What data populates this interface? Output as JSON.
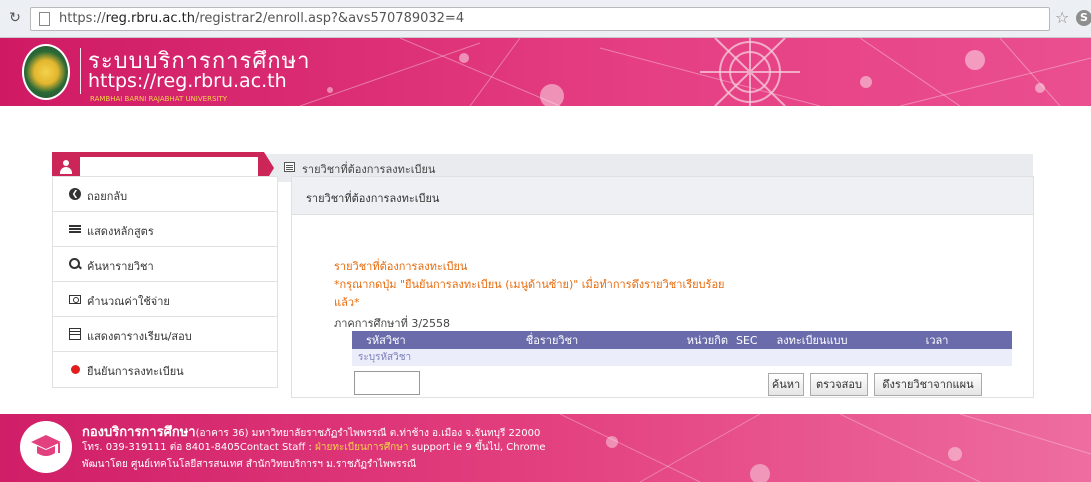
{
  "browser": {
    "url_prefix": "https://",
    "url_host": "reg.rbru.ac.th",
    "url_path": "/registrar2/enroll.asp?&avs570789032=4"
  },
  "header": {
    "title": "ระบบบริการการศึกษา",
    "url": "https://reg.rbru.ac.th",
    "university": "RAMBHAI BARNI RAJABHAT UNIVERSITY"
  },
  "breadcrumb": {
    "current": "รายวิชาที่ต้องการลงทะเบียน"
  },
  "sidebar": {
    "items": [
      {
        "label": "ถอยกลับ",
        "icon": "back-circle-icon"
      },
      {
        "label": "แสดงหลักสูตร",
        "icon": "list-icon"
      },
      {
        "label": "ค้นหารายวิชา",
        "icon": "search-icon"
      },
      {
        "label": "คำนวณค่าใช้จ่าย",
        "icon": "money-icon"
      },
      {
        "label": "แสดงตารางเรียน/สอบ",
        "icon": "calendar-icon"
      },
      {
        "label": "ยืนยันการลงทะเบียน",
        "icon": "red-dot-icon"
      }
    ]
  },
  "panel": {
    "heading": "รายวิชาที่ต้องการลงทะเบียน",
    "notice_title": "รายวิชาที่ต้องการลงทะเบียน",
    "notice_line1": "*กรุณากดปุ่ม \"ยืนยันการลงทะเบียน (เมนูด้านซ้าย)\" เมื่อทำการดึงรายวิชาเรียบร้อย",
    "notice_line2": "แล้ว*",
    "term": "ภาคการศึกษาที่ 3/2558",
    "table": {
      "headers": [
        "รหัสวิชา",
        "ชื่อรายวิชา",
        "หน่วยกิต",
        "SEC",
        "ลงทะเบียนแบบ",
        "เวลา"
      ],
      "empty_row": "ระบุรหัสวิชา"
    },
    "buttons": {
      "search": "ค้นหา",
      "check": "ตรวจสอบ",
      "pull_plan": "ดึงรายวิชาจากแผน"
    }
  },
  "footer": {
    "org": "กองบริการการศึกษา",
    "address": "(อาคาร 36) มหาวิทยาลัยราชภัฏรำไพพรรณี ต.ท่าช้าง อ.เมือง จ.จันทบุรี 22000",
    "contact_prefix": "โทร. 039-319111 ต่อ 8401-8405Contact Staff : ",
    "contact_link": "ฝ่ายทะเบียนการศึกษา",
    "contact_suffix": " support ie 9 ขึ้นไป, Chrome",
    "developer": "พัฒนาโดย ศูนย์เทคโนโลยีสารสนเทศ สำนักวิทยบริการฯ ม.ราชภัฏรำไพพรรณี"
  },
  "colors": {
    "brand_pink": "#e63f84",
    "user_block": "#cc2557",
    "table_header": "#696bab",
    "notice_orange": "#e86a0b"
  }
}
